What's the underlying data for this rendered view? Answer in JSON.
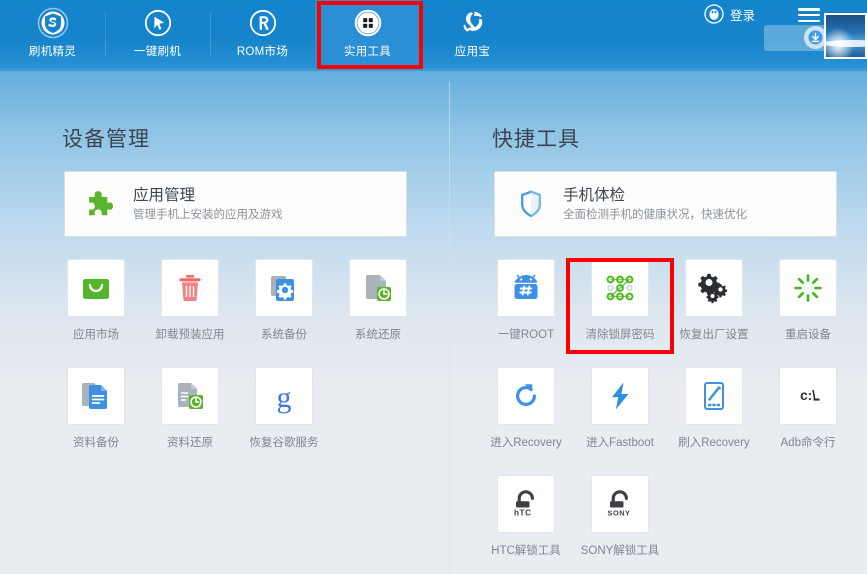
{
  "topnav": {
    "items": [
      {
        "label": "刷机精灵",
        "icon": "shield-s-icon",
        "active": false
      },
      {
        "label": "一键刷机",
        "icon": "cursor-circle-icon",
        "active": false
      },
      {
        "label": "ROM市场",
        "icon": "registered-r-icon",
        "active": false
      },
      {
        "label": "实用工具",
        "icon": "grid-squares-icon",
        "active": true
      },
      {
        "label": "应用宝",
        "icon": "app-treasure-icon",
        "active": false
      }
    ],
    "login_label": "登录",
    "login_icon": "penguin-avatar-icon",
    "menu_icon": "hamburger-menu-icon",
    "minimize_icon": "minimize-icon",
    "thumbnail_icon": "preview-thumbnail",
    "download_icon": "download-arrow-icon"
  },
  "left": {
    "title": "设备管理",
    "card": {
      "title": "应用管理",
      "subtitle": "管理手机上安装的应用及游戏",
      "icon": "puzzle-piece-icon"
    },
    "tiles": [
      {
        "label": "应用市场",
        "icon": "app-store-bag-icon"
      },
      {
        "label": "卸载预装应用",
        "icon": "trash-can-icon"
      },
      {
        "label": "系统备份",
        "icon": "system-backup-gear-icon"
      },
      {
        "label": "系统还原",
        "icon": "system-restore-clock-icon"
      },
      {
        "label": "资料备份",
        "icon": "document-backup-icon"
      },
      {
        "label": "资料还原",
        "icon": "document-restore-clock-icon"
      },
      {
        "label": "恢复谷歌服务",
        "icon": "google-g-icon"
      }
    ]
  },
  "right": {
    "title": "快捷工具",
    "card": {
      "title": "手机体检",
      "subtitle": "全面检测手机的健康状况，快速优化",
      "icon": "shield-check-icon"
    },
    "tiles": [
      {
        "label": "一键ROOT",
        "icon": "android-root-icon"
      },
      {
        "label": "清除锁屏密码",
        "icon": "pattern-lock-icon",
        "highlighted": true
      },
      {
        "label": "恢复出厂设置",
        "icon": "gears-icon"
      },
      {
        "label": "重启设备",
        "icon": "restart-burst-icon"
      },
      {
        "label": "进入Recovery",
        "icon": "refresh-arrow-icon"
      },
      {
        "label": "进入Fastboot",
        "icon": "lightning-bolt-icon"
      },
      {
        "label": "刷入Recovery",
        "icon": "phone-flash-icon"
      },
      {
        "label": "Adb命令行",
        "icon": "command-prompt-icon"
      },
      {
        "label": "HTC解锁工具",
        "icon": "htc-unlock-icon"
      },
      {
        "label": "SONY解锁工具",
        "icon": "sony-unlock-icon"
      }
    ]
  },
  "annotations": {
    "highlight_color": "#fc0000",
    "boxes": [
      {
        "target": "实用工具",
        "name": "highlight-utility-tools-tab"
      },
      {
        "target": "清除锁屏密码",
        "name": "highlight-clear-lockscreen-password"
      }
    ]
  },
  "colors": {
    "topbar_blue": "#1683ca",
    "active_tab_blue": "#2a8fd4",
    "page_bg": "#e9ecf1",
    "caption_gray": "#7f8792",
    "title_gray": "#3b4450",
    "green": "#4caf28",
    "blue_accent": "#3d9ae8"
  }
}
